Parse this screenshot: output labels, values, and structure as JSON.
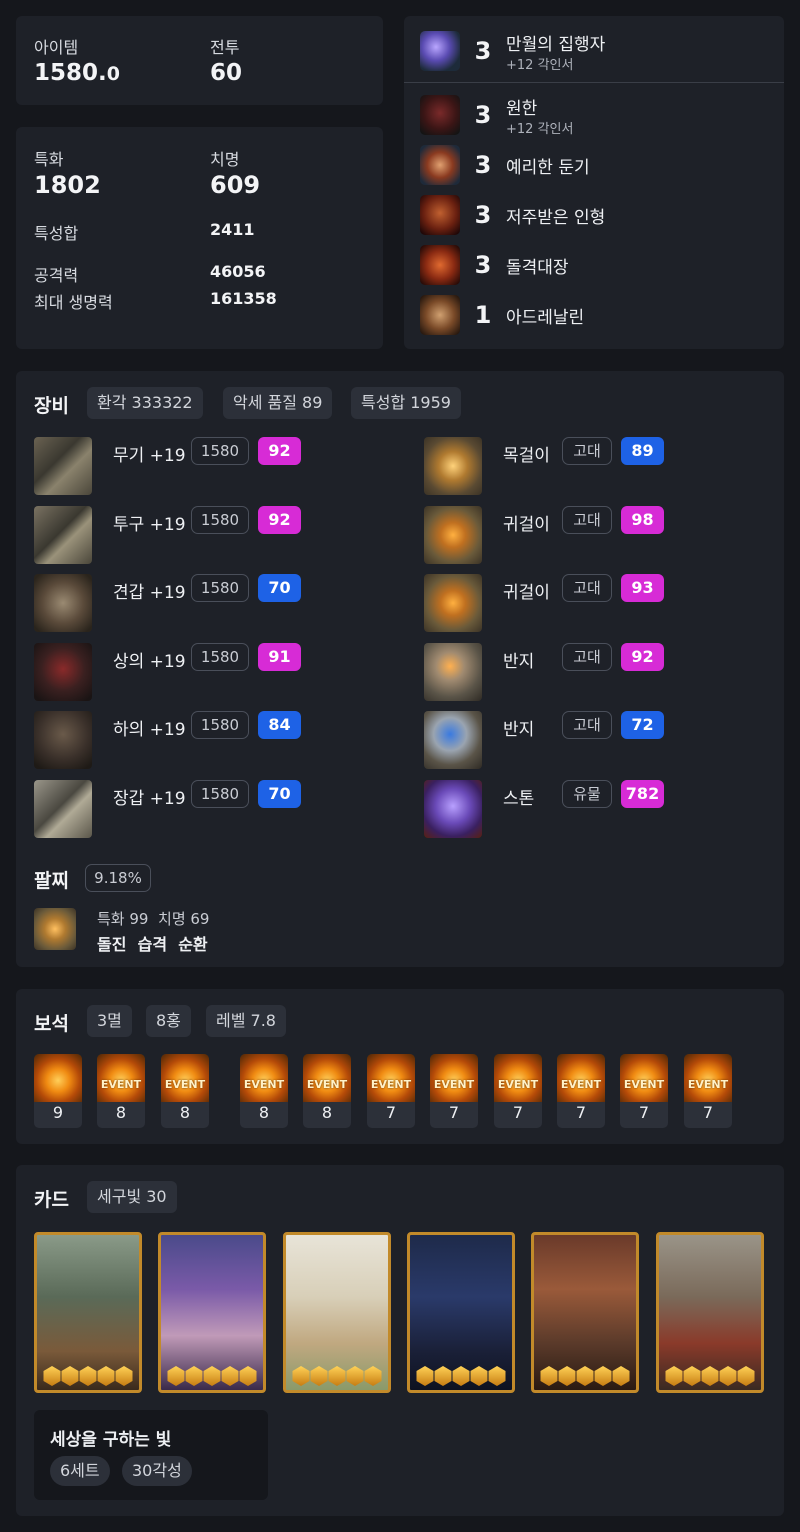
{
  "summary": {
    "item_level_label": "아이템",
    "item_level_int": "1580.",
    "item_level_dec": "0",
    "combat_label": "전투",
    "combat_value": "60"
  },
  "stats": {
    "spec_label": "특화",
    "spec_value": "1802",
    "crit_label": "치명",
    "crit_value": "609",
    "total_label": "특성합",
    "total_value": "2411",
    "atk_label": "공격력",
    "atk_value": "46056",
    "hp_label": "최대 생명력",
    "hp_value": "161358"
  },
  "engravings": [
    {
      "icon": "full-moon-executor-icon",
      "level": "3",
      "name": "만월의 집행자",
      "sub": "+12 각인서"
    },
    {
      "icon": "grudge-icon",
      "level": "3",
      "name": "원한",
      "sub": "+12 각인서"
    },
    {
      "icon": "keen-blunt-weapon-icon",
      "level": "3",
      "name": "예리한 둔기",
      "sub": ""
    },
    {
      "icon": "cursed-doll-icon",
      "level": "3",
      "name": "저주받은 인형",
      "sub": ""
    },
    {
      "icon": "raid-captain-icon",
      "level": "3",
      "name": "돌격대장",
      "sub": ""
    },
    {
      "icon": "adrenaline-icon",
      "level": "1",
      "name": "아드레날린",
      "sub": ""
    }
  ],
  "equipment": {
    "title": "장비",
    "chips": [
      "환각 333322",
      "악세 품질 89",
      "특성합 1959"
    ],
    "gear": [
      {
        "icon": "weapon-icon",
        "name": "무기 +19",
        "level": "1580",
        "quality": "92",
        "color": "#d72bd6"
      },
      {
        "icon": "helmet-icon",
        "name": "투구 +19",
        "level": "1580",
        "quality": "92",
        "color": "#d72bd6"
      },
      {
        "icon": "shoulder-icon",
        "name": "견갑 +19",
        "level": "1580",
        "quality": "70",
        "color": "#1e62e6"
      },
      {
        "icon": "chest-icon",
        "name": "상의 +19",
        "level": "1580",
        "quality": "91",
        "color": "#d72bd6"
      },
      {
        "icon": "pants-icon",
        "name": "하의 +19",
        "level": "1580",
        "quality": "84",
        "color": "#1e62e6"
      },
      {
        "icon": "gloves-icon",
        "name": "장갑 +19",
        "level": "1580",
        "quality": "70",
        "color": "#1e62e6"
      }
    ],
    "accessories": [
      {
        "icon": "necklace-icon",
        "name": "목걸이",
        "grade": "고대",
        "quality": "89",
        "color": "#1e62e6"
      },
      {
        "icon": "earring-icon",
        "name": "귀걸이",
        "grade": "고대",
        "quality": "98",
        "color": "#d72bd6"
      },
      {
        "icon": "earring-icon",
        "name": "귀걸이",
        "grade": "고대",
        "quality": "93",
        "color": "#d72bd6"
      },
      {
        "icon": "ring-icon",
        "name": "반지",
        "grade": "고대",
        "quality": "92",
        "color": "#d72bd6"
      },
      {
        "icon": "ring-icon",
        "name": "반지",
        "grade": "고대",
        "quality": "72",
        "color": "#1e62e6"
      },
      {
        "icon": "stone-icon",
        "name": "스톤",
        "grade": "유물",
        "quality": "782",
        "color": "#d72bd6"
      }
    ],
    "bracelet_title": "팔찌",
    "bracelet_chip": "9.18%",
    "bracelet_stats": [
      "특화 99",
      "치명 69"
    ],
    "bracelet_effects": [
      "돌진",
      "습격",
      "순환"
    ]
  },
  "gems": {
    "title": "보석",
    "chips": [
      "3멸",
      "8홍",
      "레벨 7.8"
    ],
    "event_label": "EVENT",
    "items": [
      {
        "level": "9",
        "event": false
      },
      {
        "level": "8",
        "event": true
      },
      {
        "level": "8",
        "event": true
      },
      {
        "level": "8",
        "event": true
      },
      {
        "level": "8",
        "event": true
      },
      {
        "level": "7",
        "event": true
      },
      {
        "level": "7",
        "event": true
      },
      {
        "level": "7",
        "event": true
      },
      {
        "level": "7",
        "event": true
      },
      {
        "level": "7",
        "event": true
      },
      {
        "level": "7",
        "event": true
      }
    ]
  },
  "cards": {
    "title": "카드",
    "chip": "세구빛 30",
    "awakening": [
      5,
      5,
      5,
      5,
      5,
      5
    ],
    "set_name": "세상을 구하는 빛",
    "set_chips": [
      "6세트",
      "30각성"
    ]
  }
}
